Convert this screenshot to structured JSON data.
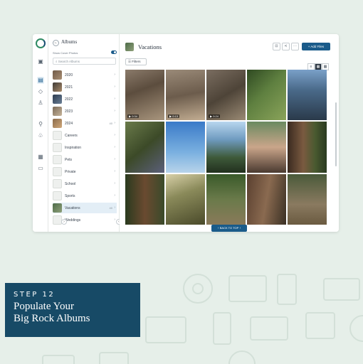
{
  "sidebar": {
    "back_icon": "back-arrow-icon",
    "title": "Albums",
    "show_cover_label": "Show Cover Photos",
    "search_placeholder": "Search Albums",
    "albums": [
      {
        "label": "2020",
        "count": ""
      },
      {
        "label": "2021",
        "count": ""
      },
      {
        "label": "2022",
        "count": ""
      },
      {
        "label": "2023",
        "count": ""
      },
      {
        "label": "2024",
        "count": "40"
      },
      {
        "label": "Careers",
        "count": ""
      },
      {
        "label": "Inspiration",
        "count": ""
      },
      {
        "label": "Pets",
        "count": ""
      },
      {
        "label": "Private",
        "count": ""
      },
      {
        "label": "School",
        "count": ""
      },
      {
        "label": "Sports",
        "count": ""
      },
      {
        "label": "Vacations",
        "count": "40"
      },
      {
        "label": "Weddings",
        "count": ""
      }
    ],
    "selected": "Vacations"
  },
  "main": {
    "title": "Vacations",
    "add_files_label": "+ Add Files",
    "filters_label": "Filters",
    "back_to_top_label": "BACK TO TOP",
    "photos": [
      {
        "name": "forest-path",
        "duration": "0:34"
      },
      {
        "name": "log-trail",
        "duration": "0:13"
      },
      {
        "name": "fallen-logs",
        "duration": "0:24"
      },
      {
        "name": "ferns",
        "duration": ""
      },
      {
        "name": "man-portrait",
        "duration": ""
      },
      {
        "name": "blue-flower",
        "duration": ""
      },
      {
        "name": "blue-sky",
        "duration": ""
      },
      {
        "name": "valley-view",
        "duration": ""
      },
      {
        "name": "couple-selfie",
        "duration": ""
      },
      {
        "name": "redwoods",
        "duration": ""
      },
      {
        "name": "giant-tree",
        "duration": ""
      },
      {
        "name": "sunlit-forest",
        "duration": ""
      },
      {
        "name": "hiker-trail",
        "duration": ""
      },
      {
        "name": "tree-trunk-hiker",
        "duration": ""
      },
      {
        "name": "man-trail",
        "duration": ""
      }
    ]
  },
  "banner": {
    "step": "STEP 12",
    "line1": "Populate Your",
    "line2": "Big Rock Albums"
  },
  "colors": {
    "primary": "#1a5b8a",
    "banner": "#174a66",
    "bg": "#e6efe9"
  }
}
